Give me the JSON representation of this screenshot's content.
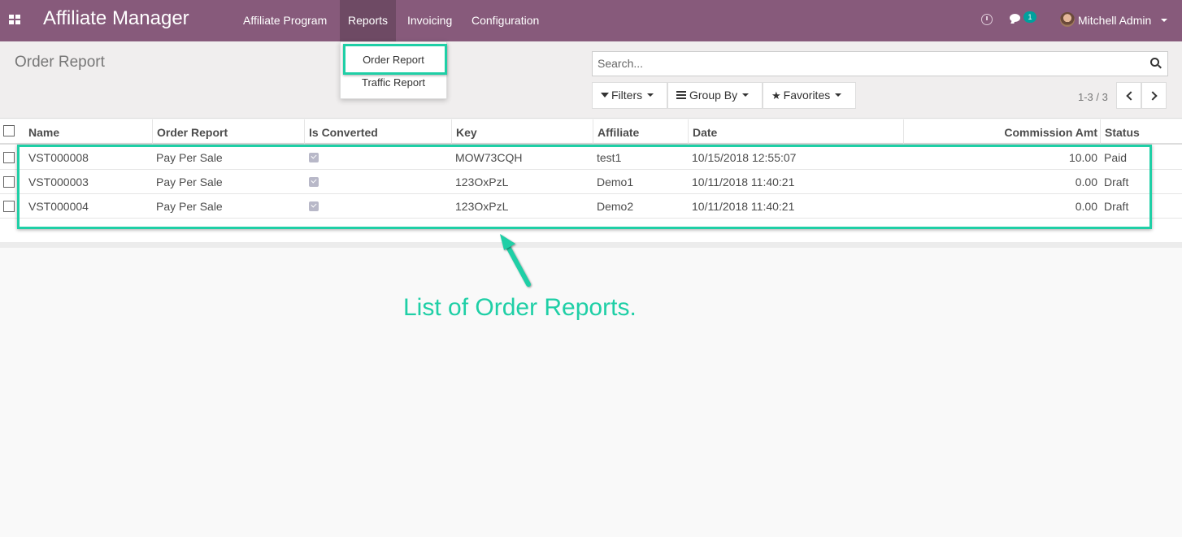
{
  "navbar": {
    "brand": "Affiliate Manager",
    "menu": [
      "Affiliate Program",
      "Reports",
      "Invoicing",
      "Configuration"
    ],
    "active_menu": "Reports",
    "chat_badge": "1",
    "user": "Mitchell Admin",
    "icons": [
      "apps-icon",
      "clock-icon",
      "chat-icon",
      "avatar"
    ]
  },
  "reports_menu": {
    "items": [
      "Order Report",
      "Traffic Report"
    ],
    "highlighted": "Order Report"
  },
  "control_panel": {
    "title": "Order Report",
    "search_placeholder": "Search...",
    "filters_label": "Filters",
    "group_by_label": "Group By",
    "favorites_label": "Favorites",
    "pager": "1-3 / 3"
  },
  "table": {
    "columns": [
      "Name",
      "Order Report",
      "Is Converted",
      "Key",
      "Affiliate",
      "Date",
      "Commission Amt",
      "Status"
    ],
    "rows": [
      {
        "name": "VST000008",
        "order_report": "Pay Per Sale",
        "is_converted": true,
        "key": "MOW73CQH",
        "affiliate": "test1",
        "date": "10/15/2018 12:55:07",
        "commission": "10.00",
        "status": "Paid"
      },
      {
        "name": "VST000003",
        "order_report": "Pay Per Sale",
        "is_converted": true,
        "key": "123OxPzL",
        "affiliate": "Demo1",
        "date": "10/11/2018 11:40:21",
        "commission": "0.00",
        "status": "Draft"
      },
      {
        "name": "VST000004",
        "order_report": "Pay Per Sale",
        "is_converted": true,
        "key": "123OxPzL",
        "affiliate": "Demo2",
        "date": "10/11/2018 11:40:21",
        "commission": "0.00",
        "status": "Draft"
      }
    ]
  },
  "annotation": {
    "text": "List of Order Reports."
  },
  "colors": {
    "navbar": "#875a7b",
    "navbar_active": "#6e4a64",
    "highlight": "#1fcfa6",
    "badge": "#00a09d"
  }
}
